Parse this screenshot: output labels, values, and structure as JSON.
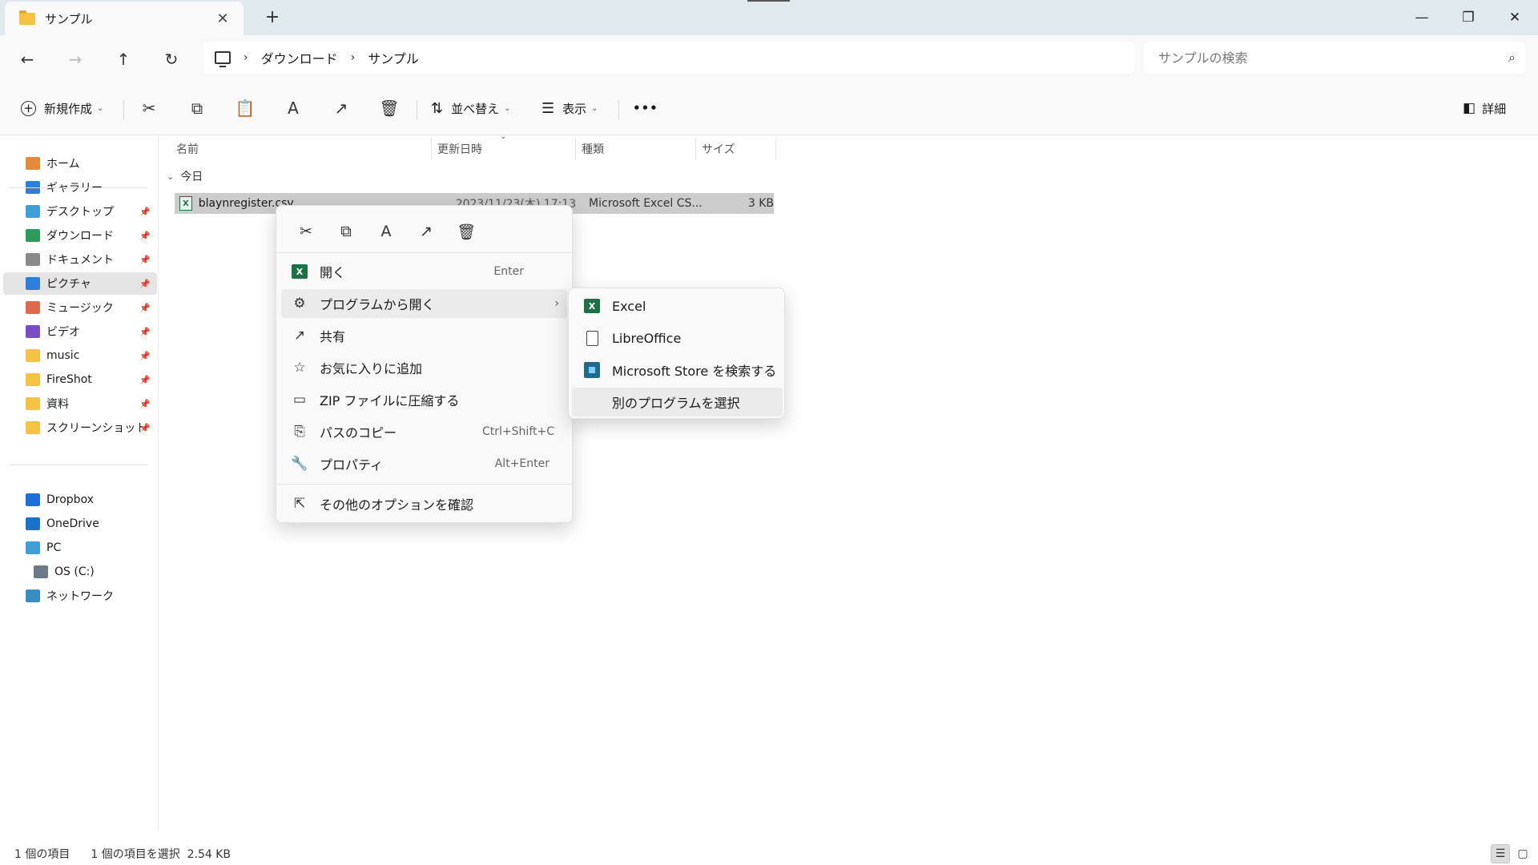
{
  "window": {
    "tab_title": "サンプル",
    "tab_close": "✕",
    "new_tab": "+",
    "controls": {
      "minimize": "—",
      "maximize": "❐",
      "close": "✕"
    }
  },
  "nav": {
    "back": "←",
    "forward": "→",
    "up": "↑",
    "refresh": "↻",
    "breadcrumb": [
      "ダウンロード",
      "サンプル"
    ],
    "breadcrumb_sep": "›",
    "search_placeholder": "サンプルの検索",
    "search_icon": "⌕"
  },
  "commands": {
    "new_label": "新規作成",
    "new_icon": "+",
    "caret": "⌄",
    "cut": "✂",
    "copy": "⧉",
    "paste": "📋",
    "rename": "A",
    "share": "↗",
    "delete": "🗑",
    "sort_icon": "⇅",
    "sort_label": "並べ替え",
    "view_icon": "☰",
    "view_label": "表示",
    "more": "•••",
    "details_icon": "◧",
    "details_label": "詳細"
  },
  "sidebar": {
    "pin": "📌",
    "quick": [
      {
        "label": "ホーム",
        "color": "#e38a3b"
      },
      {
        "label": "ギャラリー",
        "color": "#2f7ed8"
      }
    ],
    "pinned": [
      {
        "label": "デスクトップ",
        "color": "#3fa0d8"
      },
      {
        "label": "ダウンロード",
        "color": "#2b9b5a"
      },
      {
        "label": "ドキュメント",
        "color": "#8a8a8a"
      },
      {
        "label": "ピクチャ",
        "color": "#2f7ed8"
      },
      {
        "label": "ミュージック",
        "color": "#e0684b"
      },
      {
        "label": "ビデオ",
        "color": "#7b4bc4"
      },
      {
        "label": "music",
        "color": "#f5c242"
      },
      {
        "label": "FireShot",
        "color": "#f5c242"
      },
      {
        "label": "資料",
        "color": "#f5c242"
      },
      {
        "label": "スクリーンショット",
        "color": "#f5c242"
      }
    ],
    "locations": [
      {
        "label": "Dropbox",
        "color": "#1e6fd9"
      },
      {
        "label": "OneDrive",
        "color": "#1a73c9"
      },
      {
        "label": "PC",
        "color": "#3fa0d8"
      },
      {
        "label": "OS (C:)",
        "color": "#6a7a88"
      },
      {
        "label": "ネットワーク",
        "color": "#3a8cc4"
      }
    ]
  },
  "columns": {
    "name": "名前",
    "date": "更新日時",
    "type": "種類",
    "size": "サイズ",
    "sort_caret": "⌄"
  },
  "group": {
    "chevron": "⌄",
    "label": "今日"
  },
  "file": {
    "icon": "X",
    "name": "blaynregister.csv",
    "date": "2023/11/23(木) 17:13",
    "type": "Microsoft Excel CS...",
    "size": "3 KB"
  },
  "context_menu": {
    "quick": [
      "✂",
      "⧉",
      "A",
      "↗",
      "🗑"
    ],
    "items": [
      {
        "label": "開く",
        "shortcut": "Enter",
        "icon": "X"
      },
      {
        "label": "プログラムから開く",
        "arrow": "›",
        "icon": "⚙"
      },
      {
        "label": "共有",
        "icon": "↗"
      },
      {
        "label": "お気に入りに追加",
        "icon": "☆"
      },
      {
        "label": "ZIP ファイルに圧縮する",
        "icon": "▭"
      },
      {
        "label": "パスのコピー",
        "shortcut": "Ctrl+Shift+C",
        "icon": "⎘"
      },
      {
        "label": "プロパティ",
        "shortcut": "Alt+Enter",
        "icon": "🔧"
      },
      {
        "label": "その他のオプションを確認",
        "icon": "⇱"
      }
    ]
  },
  "submenu": {
    "items": [
      {
        "label": "Excel",
        "icon": "X"
      },
      {
        "label": "LibreOffice"
      },
      {
        "label": "Microsoft Store を検索する"
      },
      {
        "label": "別のプログラムを選択"
      }
    ]
  },
  "status": {
    "count": "1 個の項目",
    "selection": "1 個の項目を選択  2.54 KB",
    "view_details": "☰",
    "view_tiles": "▢"
  }
}
